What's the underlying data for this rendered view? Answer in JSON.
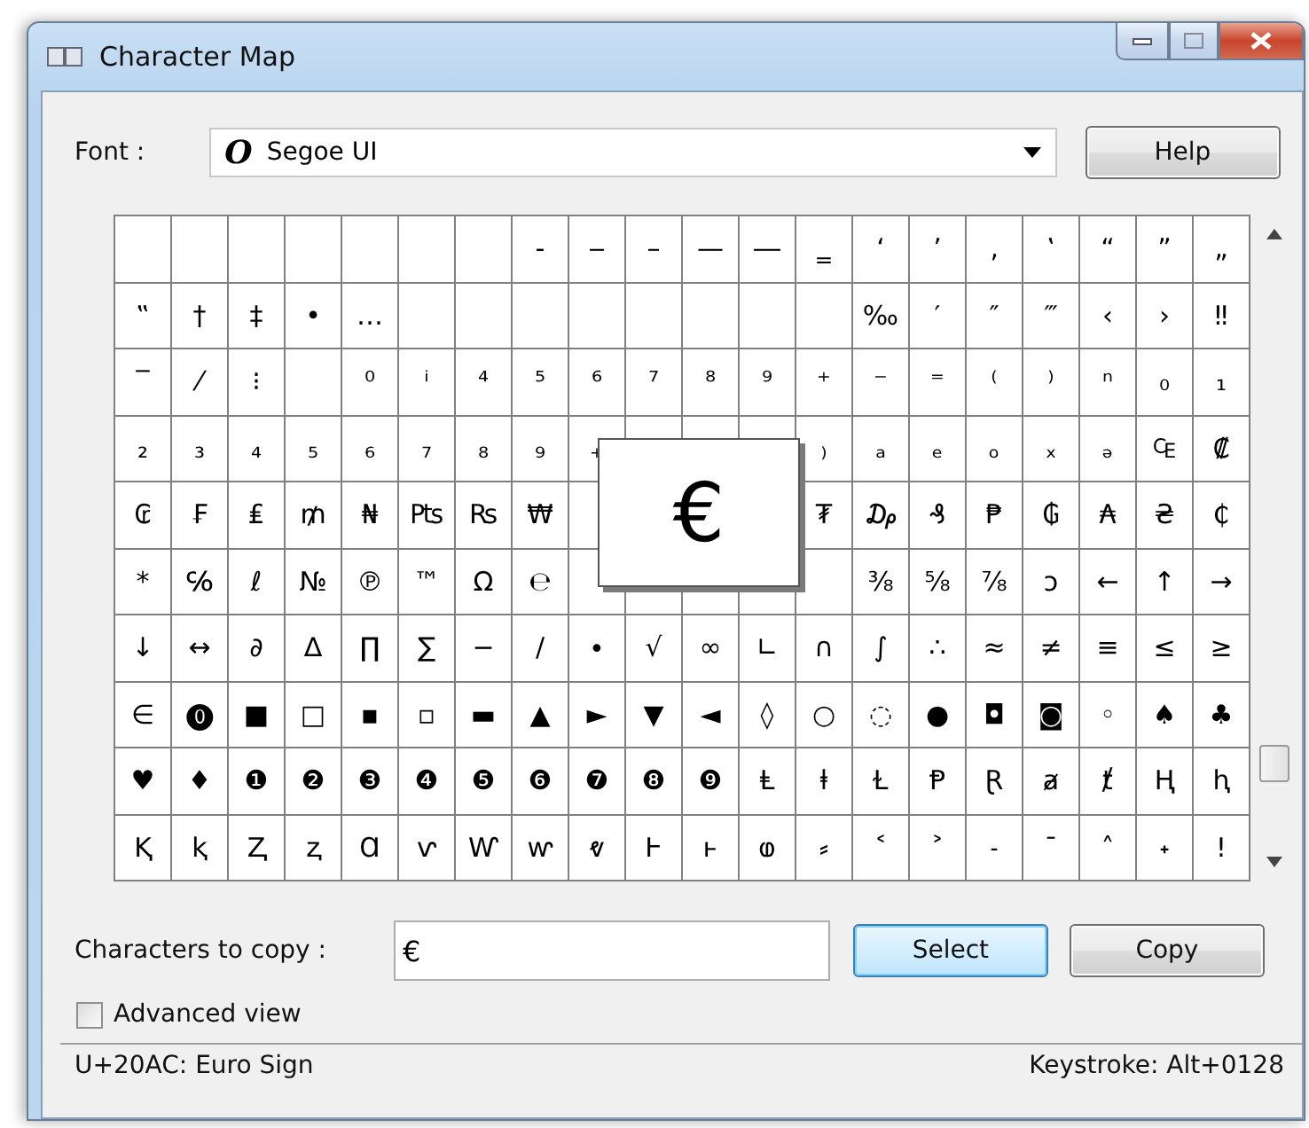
{
  "window": {
    "title": "Character Map"
  },
  "font": {
    "label": "Font :",
    "value": "Segoe UI",
    "font_glyph": "O"
  },
  "help_button": "Help",
  "grid": {
    "rows": [
      [
        "",
        "",
        "",
        "",
        "",
        "",
        "",
        "‐",
        "‒",
        "–",
        "—",
        "―",
        "‗",
        "‘",
        "’",
        "‚",
        "‛",
        "“",
        "”",
        "„"
      ],
      [
        "‟",
        "†",
        "‡",
        "•",
        "…",
        "",
        "",
        "",
        "",
        "",
        "",
        "",
        "",
        "‰",
        "′",
        "″",
        "‴",
        "‹",
        "›",
        "‼"
      ],
      [
        "‾",
        "⁄",
        "⁝",
        "",
        "⁰",
        "ⁱ",
        "⁴",
        "⁵",
        "⁶",
        "⁷",
        "⁸",
        "⁹",
        "⁺",
        "⁻",
        "⁼",
        "⁽",
        "⁾",
        "ⁿ",
        "₀",
        "₁"
      ],
      [
        "₂",
        "₃",
        "₄",
        "₅",
        "₆",
        "₇",
        "₈",
        "₉",
        "₊",
        null,
        null,
        null,
        "₎",
        "ₐ",
        "ₑ",
        "ₒ",
        "ₓ",
        "ₔ",
        "₠",
        "₡"
      ],
      [
        "₢",
        "₣",
        "₤",
        "₥",
        "₦",
        "₧",
        "₨",
        "₩",
        null,
        null,
        null,
        null,
        "₮",
        "₯",
        "₰",
        "₱",
        "₲",
        "₳",
        "₴",
        "₵"
      ],
      [
        "*",
        "℅",
        "ℓ",
        "№",
        "℗",
        "™",
        "Ω",
        "℮",
        null,
        null,
        null,
        null,
        null,
        "⅜",
        "⅝",
        "⅞",
        "ↄ",
        "←",
        "↑",
        "→"
      ],
      [
        "↓",
        "↔",
        "∂",
        "∆",
        "∏",
        "∑",
        "−",
        "∕",
        "∙",
        "√",
        "∞",
        "∟",
        "∩",
        "∫",
        "∴",
        "≈",
        "≠",
        "≡",
        "≤",
        "≥"
      ],
      [
        "∈",
        "⓿",
        "■",
        "□",
        "▪",
        "▫",
        "▬",
        "▲",
        "►",
        "▼",
        "◄",
        "◊",
        "○",
        "◌",
        "●",
        "◘",
        "◙",
        "◦",
        "♠",
        "♣"
      ],
      [
        "♥",
        "♦",
        "❶",
        "❷",
        "❸",
        "❹",
        "❺",
        "❻",
        "❼",
        "❽",
        "❾",
        "Ⱡ",
        "ⱡ",
        "Ɫ",
        "Ᵽ",
        "Ɽ",
        "ⱥ",
        "ⱦ",
        "Ⱨ",
        "ⱨ"
      ],
      [
        "Ⱪ",
        "ⱪ",
        "Ⱬ",
        "ⱬ",
        "Ɑ",
        "ⱱ",
        "Ⱳ",
        "ⱳ",
        "ⱴ",
        "Ⱶ",
        "ⱶ",
        "ⱷ",
        "⸗",
        "˂",
        "˃",
        "˗",
        "¯",
        "˄",
        "˖",
        "ǃ"
      ]
    ],
    "popup": "€"
  },
  "copy": {
    "label": "Characters to copy :",
    "value": "€",
    "select_button": "Select",
    "copy_button": "Copy"
  },
  "advanced_view": {
    "label": "Advanced view",
    "checked": false
  },
  "status_bar": {
    "left": "U+20AC: Euro Sign",
    "right": "Keystroke: Alt+0128"
  }
}
